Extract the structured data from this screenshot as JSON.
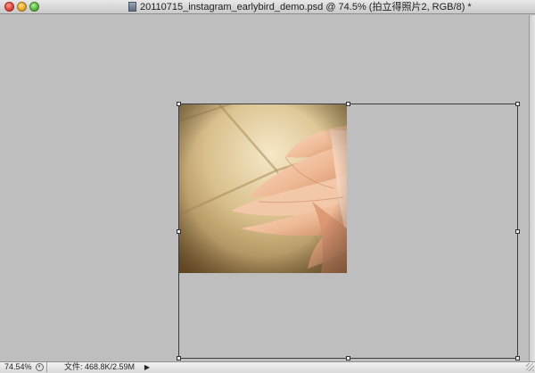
{
  "window": {
    "title": "20110715_instagram_earlybird_demo.psd @ 74.5% (拍立得照片2, RGB/8) *"
  },
  "statusbar": {
    "zoom": "74.54%",
    "doc_info": "文件: 468.8K/2.59M",
    "arrow": "▶"
  },
  "icons": {
    "close": "close-button",
    "minimize": "minimize-button",
    "maximize": "zoom-button",
    "document": "document-icon",
    "zoom_options": "zoom-options-icon",
    "resize_grip": "resize-grip-icon"
  }
}
